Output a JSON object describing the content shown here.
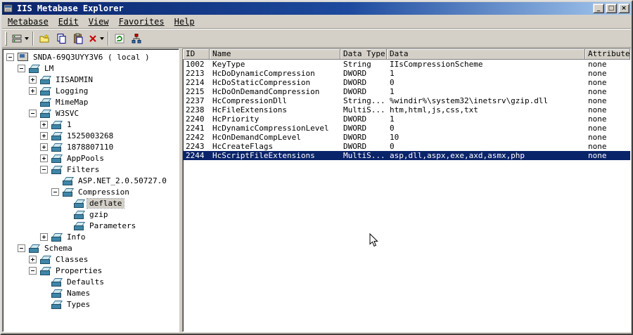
{
  "window": {
    "title": "IIS Metabase Explorer",
    "controls": {
      "minimize": "_",
      "maximize": "□",
      "close": "×"
    }
  },
  "menu": {
    "items": [
      {
        "label": "Metabase"
      },
      {
        "label": "Edit"
      },
      {
        "label": "View"
      },
      {
        "label": "Favorites"
      },
      {
        "label": "Help"
      }
    ]
  },
  "toolbar": {
    "buttons": [
      "connect-icon",
      "new-key-icon",
      "copy-icon",
      "paste-icon",
      "delete-icon",
      "refresh-icon",
      "topology-icon"
    ]
  },
  "tree": {
    "items": [
      {
        "label": "SNDA-69Q3UYY3V6 ( local )",
        "icon": "computer-icon",
        "expanded": true
      },
      {
        "label": "LM",
        "icon": "node-icon",
        "expanded": true
      },
      {
        "label": "IISADMIN",
        "icon": "node-icon",
        "expanded": false
      },
      {
        "label": "Logging",
        "icon": "node-icon",
        "expanded": false
      },
      {
        "label": "MimeMap",
        "icon": "node-icon"
      },
      {
        "label": "W3SVC",
        "icon": "node-icon",
        "expanded": true
      },
      {
        "label": "1",
        "icon": "node-icon",
        "expanded": false
      },
      {
        "label": "1525003268",
        "icon": "node-icon",
        "expanded": false
      },
      {
        "label": "1878807110",
        "icon": "node-icon",
        "expanded": false
      },
      {
        "label": "AppPools",
        "icon": "node-icon",
        "expanded": false
      },
      {
        "label": "Filters",
        "icon": "node-icon",
        "expanded": true
      },
      {
        "label": "ASP.NET_2.0.50727.0",
        "icon": "node-icon"
      },
      {
        "label": "Compression",
        "icon": "node-icon",
        "expanded": true
      },
      {
        "label": "deflate",
        "icon": "node-icon",
        "selected": true
      },
      {
        "label": "gzip",
        "icon": "node-icon"
      },
      {
        "label": "Parameters",
        "icon": "node-icon"
      },
      {
        "label": "Info",
        "icon": "node-icon",
        "expanded": false
      },
      {
        "label": "Schema",
        "icon": "node-icon",
        "expanded": true
      },
      {
        "label": "Classes",
        "icon": "node-icon",
        "expanded": false
      },
      {
        "label": "Properties",
        "icon": "node-icon",
        "expanded": true
      },
      {
        "label": "Defaults",
        "icon": "node-icon"
      },
      {
        "label": "Names",
        "icon": "node-icon"
      },
      {
        "label": "Types",
        "icon": "node-icon"
      }
    ]
  },
  "table": {
    "columns": [
      "ID",
      "Name",
      "Data Type",
      "Data",
      "Attributes"
    ],
    "rows": [
      {
        "id": "1002",
        "name": "KeyType",
        "type": "String",
        "data": "IIsCompressionScheme",
        "attrs": "none"
      },
      {
        "id": "2213",
        "name": "HcDoDynamicCompression",
        "type": "DWORD",
        "data": "1",
        "attrs": "none"
      },
      {
        "id": "2214",
        "name": "HcDoStaticCompression",
        "type": "DWORD",
        "data": "0",
        "attrs": "none"
      },
      {
        "id": "2215",
        "name": "HcDoOnDemandCompression",
        "type": "DWORD",
        "data": "1",
        "attrs": "none"
      },
      {
        "id": "2237",
        "name": "HcCompressionDll",
        "type": "String...",
        "data": "%windir%\\system32\\inetsrv\\gzip.dll",
        "attrs": "none"
      },
      {
        "id": "2238",
        "name": "HcFileExtensions",
        "type": "MultiS...",
        "data": "htm,html,js,css,txt",
        "attrs": "none"
      },
      {
        "id": "2240",
        "name": "HcPriority",
        "type": "DWORD",
        "data": "1",
        "attrs": "none"
      },
      {
        "id": "2241",
        "name": "HcDynamicCompressionLevel",
        "type": "DWORD",
        "data": "0",
        "attrs": "none"
      },
      {
        "id": "2242",
        "name": "HcOnDemandCompLevel",
        "type": "DWORD",
        "data": "10",
        "attrs": "none"
      },
      {
        "id": "2243",
        "name": "HcCreateFlags",
        "type": "DWORD",
        "data": "0",
        "attrs": "none"
      },
      {
        "id": "2244",
        "name": "HcScriptFileExtensions",
        "type": "MultiS...",
        "data": "asp,dll,aspx,exe,axd,asmx,php",
        "attrs": "none",
        "selected": true
      }
    ]
  }
}
